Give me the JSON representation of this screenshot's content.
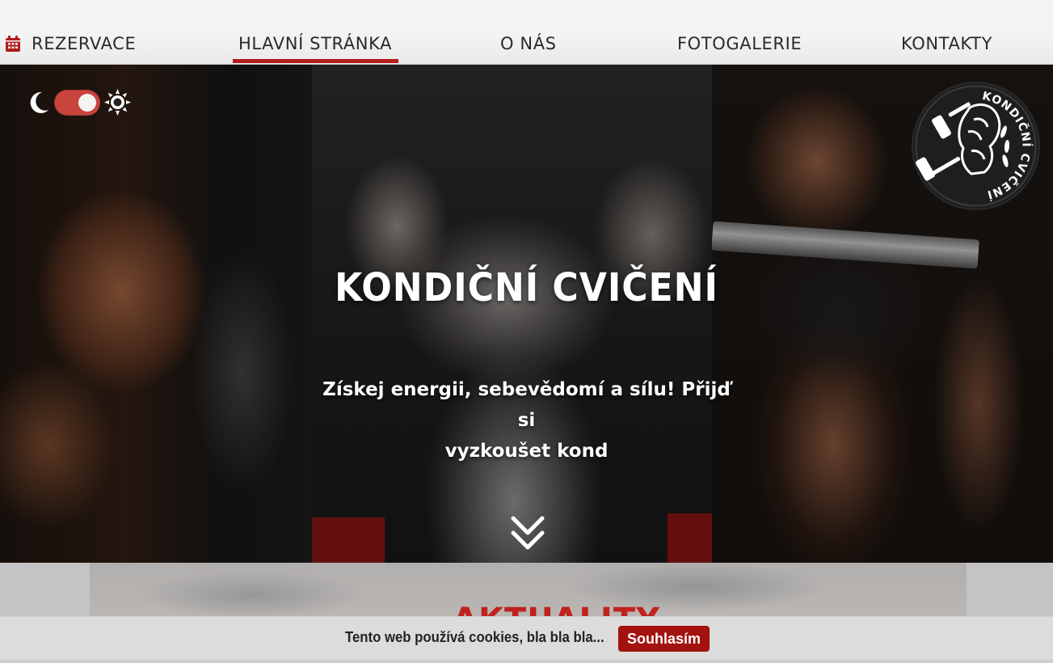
{
  "nav": {
    "reservation_label": "REZERVACE",
    "home_label": "HLAVNÍ STRÁNKA",
    "about_label": "O NÁS",
    "gallery_label": "FOTOGALERIE",
    "contacts_label": "KONTAKTY",
    "active": "home"
  },
  "hero": {
    "title": "KONDIČNÍ CVIČENÍ",
    "subtitle_line1": "Získej energii, sebevědomí a sílu! Přijď si",
    "subtitle_line2": "vyzkoušet kond"
  },
  "logo": {
    "text": "KONDIČNÍ CVIČENÍ"
  },
  "theme_toggle": {
    "state": "light"
  },
  "news": {
    "heading": "AKTUALITY"
  },
  "cookie": {
    "text": "Tento web používá cookies, bla bla bla...",
    "accept_label": "Souhlasím"
  },
  "colors": {
    "accent": "#b11d1a",
    "toggle": "#c9443d",
    "cookie_button": "#a3120f"
  },
  "icons": {
    "calendar": "calendar-icon",
    "moon": "moon-icon",
    "sun": "sun-icon",
    "scroll_down": "chevron-double-down-icon"
  }
}
